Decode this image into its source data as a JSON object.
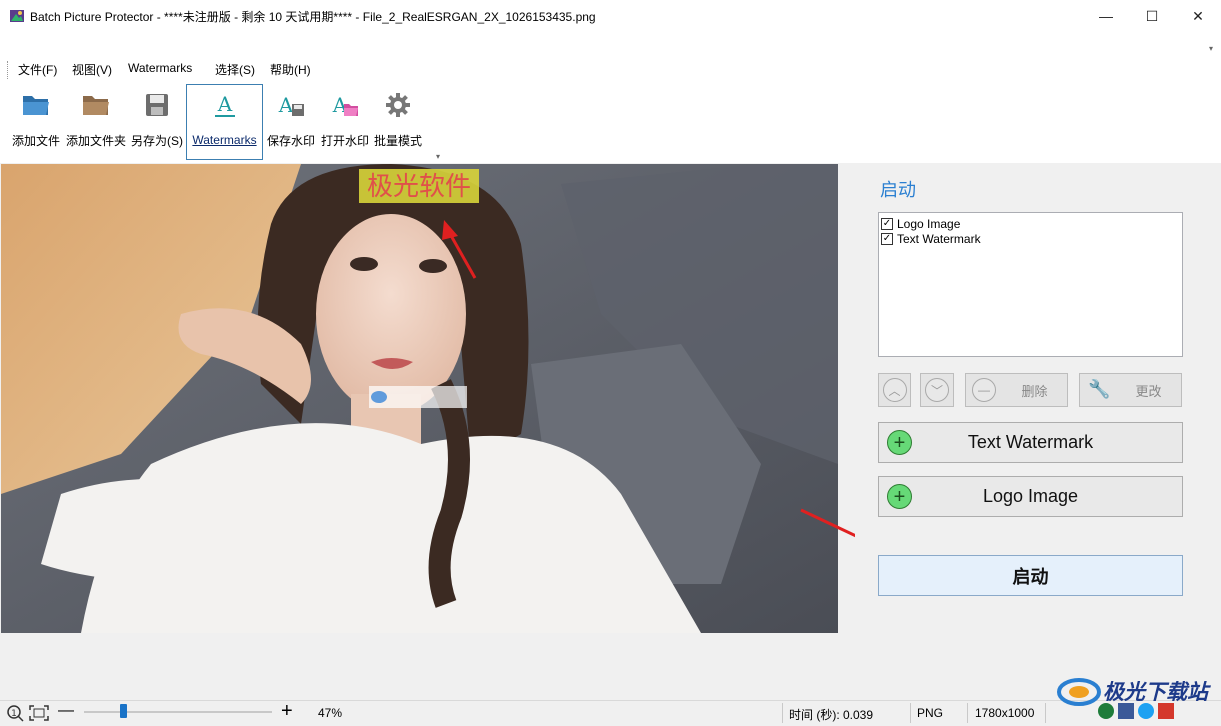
{
  "window": {
    "title": "Batch Picture Protector - ****未注册版 - 剩余 10 天试用期**** - File_2_RealESRGAN_2X_1026153435.png",
    "minimize": "—",
    "maximize": "☐",
    "close": "✕"
  },
  "menu": [
    "文件(F)",
    "视图(V)",
    "Watermarks",
    "选择(S)",
    "帮助(H)"
  ],
  "toolbar": [
    {
      "label": "添加文件",
      "icon": "folder-open-icon"
    },
    {
      "label": "添加文件夹",
      "icon": "folder-icon"
    },
    {
      "label": "另存为(S)",
      "icon": "save-icon"
    },
    {
      "label": "Watermarks",
      "icon": "text-watermark-icon"
    },
    {
      "label": "保存水印",
      "icon": "save-watermark-icon"
    },
    {
      "label": "打开水印",
      "icon": "open-watermark-icon"
    },
    {
      "label": "批量模式",
      "icon": "gear-icon"
    }
  ],
  "image": {
    "watermark_text": "极光软件"
  },
  "panel": {
    "title": "启动",
    "layers": [
      {
        "label": "Logo Image",
        "checked": true
      },
      {
        "label": "Text Watermark",
        "checked": true
      }
    ],
    "delete_label": "删除",
    "edit_label": "更改",
    "add_text_label": "Text Watermark",
    "add_logo_label": "Logo Image",
    "start_label": "启动"
  },
  "status": {
    "zoom": "47%",
    "time": "时间 (秒): 0.039",
    "format": "PNG",
    "size": "1780x1000"
  },
  "brand": "极光下载站",
  "colors": {
    "accent": "#2a7fd1",
    "arrow": "#e02020",
    "watermark_bg": "#d8d43a",
    "watermark_text": "#e0504a"
  }
}
